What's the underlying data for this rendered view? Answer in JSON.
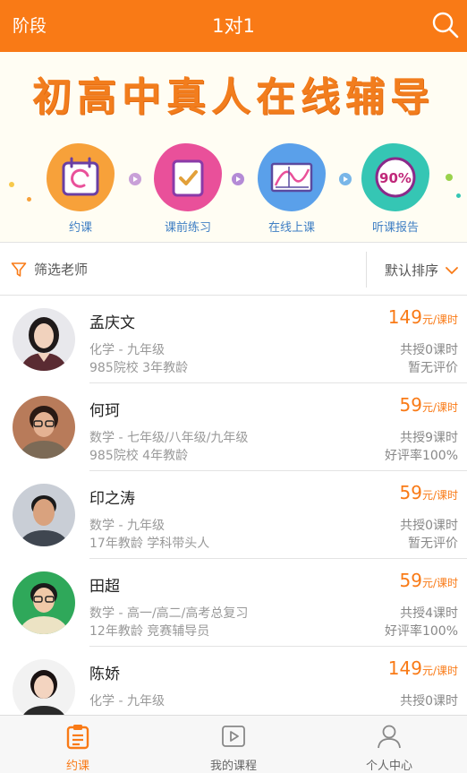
{
  "header": {
    "stage_label": "阶段",
    "title": "1对1",
    "search_icon": "search-icon"
  },
  "banner": {
    "slogan": "初高中真人在线辅导",
    "steps": [
      {
        "label": "约课",
        "icon": "calendar-icon",
        "color": "#f7a13a"
      },
      {
        "label": "课前练习",
        "icon": "checklist-icon",
        "color": "#e9509a"
      },
      {
        "label": "在线上课",
        "icon": "chart-board-icon",
        "color": "#5aa0ea"
      },
      {
        "label": "听课报告",
        "icon": "report-badge-icon",
        "color": "#35c6b4",
        "badge": "90%"
      }
    ]
  },
  "filter": {
    "label": "筛选老师",
    "sort_label": "默认排序"
  },
  "teachers": [
    {
      "name": "孟庆文",
      "subject": "化学 - 九年级",
      "info": "985院校 3年教龄",
      "price": "149",
      "unit": "元/课时",
      "hours": "共授0课时",
      "rating": "暂无评价"
    },
    {
      "name": "何珂",
      "subject": "数学 - 七年级/八年级/九年级",
      "info": "985院校 4年教龄",
      "price": "59",
      "unit": "元/课时",
      "hours": "共授9课时",
      "rating": "好评率100%"
    },
    {
      "name": "印之涛",
      "subject": "数学 - 九年级",
      "info": "17年教龄 学科带头人",
      "price": "59",
      "unit": "元/课时",
      "hours": "共授0课时",
      "rating": "暂无评价"
    },
    {
      "name": "田超",
      "subject": "数学 - 高一/高二/高考总复习",
      "info": "12年教龄 竞赛辅导员",
      "price": "59",
      "unit": "元/课时",
      "hours": "共授4课时",
      "rating": "好评率100%"
    },
    {
      "name": "陈娇",
      "subject": "化学 - 九年级",
      "info": "",
      "price": "149",
      "unit": "元/课时",
      "hours": "共授0课时",
      "rating": ""
    }
  ],
  "tabs": [
    {
      "label": "约课",
      "icon": "clipboard-icon",
      "active": true
    },
    {
      "label": "我的课程",
      "icon": "play-icon",
      "active": false
    },
    {
      "label": "个人中心",
      "icon": "person-icon",
      "active": false
    }
  ],
  "colors": {
    "accent": "#f97a16",
    "link_blue": "#3f7fc4"
  }
}
